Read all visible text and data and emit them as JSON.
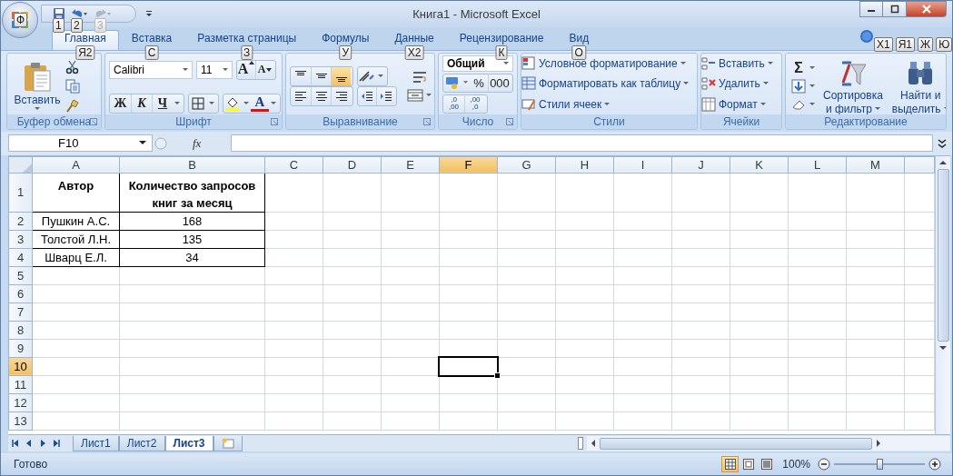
{
  "window": {
    "title": "Книга1 - Microsoft Excel",
    "office_button_keytip": "Ф"
  },
  "quick_access": [
    {
      "kind": "save",
      "keytip": "1",
      "disabled": false
    },
    {
      "kind": "undo",
      "keytip": "2",
      "disabled": false
    },
    {
      "kind": "redo",
      "keytip": "3",
      "disabled": true
    }
  ],
  "tabs": [
    {
      "label": "Главная",
      "keytip": "Я2",
      "selected": true
    },
    {
      "label": "Вставка",
      "keytip": "С",
      "selected": false
    },
    {
      "label": "Разметка страницы",
      "keytip": "З",
      "selected": false
    },
    {
      "label": "Формулы",
      "keytip": "У",
      "selected": false
    },
    {
      "label": "Данные",
      "keytip": "Х2",
      "selected": false
    },
    {
      "label": "Рецензирование",
      "keytip": "К",
      "selected": false
    },
    {
      "label": "Вид",
      "keytip": "О",
      "selected": false
    }
  ],
  "window_keytips": [
    "Х1",
    "Я1",
    "Ж",
    "Ю"
  ],
  "ribbon": {
    "clipboard": {
      "label": "Буфер обмена",
      "paste": "Вставить"
    },
    "font": {
      "label": "Шрифт",
      "font_name": "Calibri",
      "font_size": "11",
      "grow": "A",
      "shrink": "A",
      "bold": "Ж",
      "italic": "К",
      "underline": "Ч",
      "font_color": "A"
    },
    "alignment": {
      "label": "Выравнивание",
      "vertical": [
        {
          "kind": "top",
          "selected": false
        },
        {
          "kind": "middle",
          "selected": false
        },
        {
          "kind": "bottom",
          "selected": true
        }
      ],
      "horizontal": [
        {
          "kind": "left",
          "selected": false
        },
        {
          "kind": "center",
          "selected": false
        },
        {
          "kind": "right",
          "selected": false
        }
      ]
    },
    "number": {
      "label": "Число",
      "format": "Общий",
      "percent": "%",
      "thousands": "000",
      "decimals": [
        {
          "top": ",0",
          "bottom": ",00"
        },
        {
          "top": ",00",
          "bottom": ",0"
        }
      ]
    },
    "styles": {
      "label": "Стили",
      "items": [
        {
          "kind": "conditional",
          "label": "Условное форматирование"
        },
        {
          "kind": "table",
          "label": "Форматировать как таблицу"
        },
        {
          "kind": "cell",
          "label": "Стили ячеек"
        }
      ]
    },
    "cells": {
      "label": "Ячейки",
      "items": [
        {
          "kind": "insert",
          "label": "Вставить"
        },
        {
          "kind": "delete",
          "label": "Удалить"
        },
        {
          "kind": "format",
          "label": "Формат"
        }
      ]
    },
    "editing": {
      "label": "Редактирование",
      "sum": "Σ",
      "sort": [
        "Сортировка",
        "и фильтр"
      ],
      "find": [
        "Найти и",
        "выделить"
      ]
    }
  },
  "formula_bar": {
    "name_box": "F10",
    "fx": "fx"
  },
  "grid": {
    "columns": [
      {
        "label": "A",
        "selected": false
      },
      {
        "label": "B",
        "selected": false
      },
      {
        "label": "C",
        "selected": false
      },
      {
        "label": "D",
        "selected": false
      },
      {
        "label": "E",
        "selected": false
      },
      {
        "label": "F",
        "selected": true
      },
      {
        "label": "G",
        "selected": false
      },
      {
        "label": "H",
        "selected": false
      },
      {
        "label": "I",
        "selected": false
      },
      {
        "label": "J",
        "selected": false
      },
      {
        "label": "K",
        "selected": false
      },
      {
        "label": "L",
        "selected": false
      },
      {
        "label": "M",
        "selected": false
      }
    ],
    "row_headers": [
      {
        "label": "1",
        "selected": false
      },
      {
        "label": "2",
        "selected": false
      },
      {
        "label": "3",
        "selected": false
      },
      {
        "label": "4",
        "selected": false
      },
      {
        "label": "5",
        "selected": false
      },
      {
        "label": "6",
        "selected": false
      },
      {
        "label": "7",
        "selected": false
      },
      {
        "label": "8",
        "selected": false
      },
      {
        "label": "9",
        "selected": false
      },
      {
        "label": "10",
        "selected": true
      },
      {
        "label": "11",
        "selected": false
      },
      {
        "label": "12",
        "selected": false
      },
      {
        "label": "13",
        "selected": false
      }
    ],
    "cells": [
      [
        "Автор",
        "Количество запросов книг за месяц"
      ],
      [
        "Пушкин А.С.",
        "168"
      ],
      [
        "Толстой Л.Н.",
        "135"
      ],
      [
        "Шварц Е.Л.",
        "34"
      ]
    ]
  },
  "sheet_tabs": [
    {
      "label": "Лист1",
      "selected": false
    },
    {
      "label": "Лист2",
      "selected": false
    },
    {
      "label": "Лист3",
      "selected": true
    }
  ],
  "status_bar": {
    "status": "Готово",
    "views": [
      {
        "kind": "normal",
        "selected": true
      },
      {
        "kind": "layout",
        "selected": false
      },
      {
        "kind": "page_break",
        "selected": false
      }
    ],
    "zoom": "100%",
    "zoom_slider": {
      "level": 0.5
    }
  }
}
